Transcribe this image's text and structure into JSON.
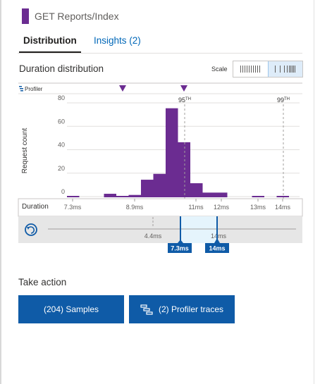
{
  "header": {
    "title": "GET Reports/Index"
  },
  "tabs": [
    {
      "label": "Distribution"
    },
    {
      "label": "Insights (2)"
    }
  ],
  "section": {
    "title": "Duration distribution"
  },
  "scale": {
    "label": "Scale",
    "selected": "log"
  },
  "profiler_label": "Profiler",
  "chart_data": {
    "type": "bar",
    "ylabel": "Request count",
    "xlabel": "Duration",
    "ylim": [
      0,
      80
    ],
    "y_ticks": [
      0,
      20,
      40,
      60,
      80
    ],
    "x_tick_labels": [
      "7.3ms",
      "8.9ms",
      "11ms",
      "12ms",
      "13ms",
      "14ms"
    ],
    "values": [
      1,
      0,
      0,
      3,
      1,
      2,
      15,
      20,
      76,
      47,
      12,
      4,
      4,
      0,
      0,
      1,
      0,
      1
    ],
    "percentiles": [
      {
        "label": "95",
        "suffix": "TH"
      },
      {
        "label": "99",
        "suffix": "TH"
      }
    ],
    "grid": true,
    "colors": {
      "bar": "#6b2c91",
      "axis": "#c8c6c4",
      "grid": "#e1dfdd"
    }
  },
  "range": {
    "min_label": "4.4ms",
    "max_label": "14ms",
    "selected_start": "7.3ms",
    "selected_end": "14ms",
    "handle_color": "#0f5ba7",
    "reset_icon": "reset-icon"
  },
  "actions": {
    "title": "Take action",
    "samples_label": "(204) Samples",
    "profiler_label": "(2) Profiler traces"
  }
}
